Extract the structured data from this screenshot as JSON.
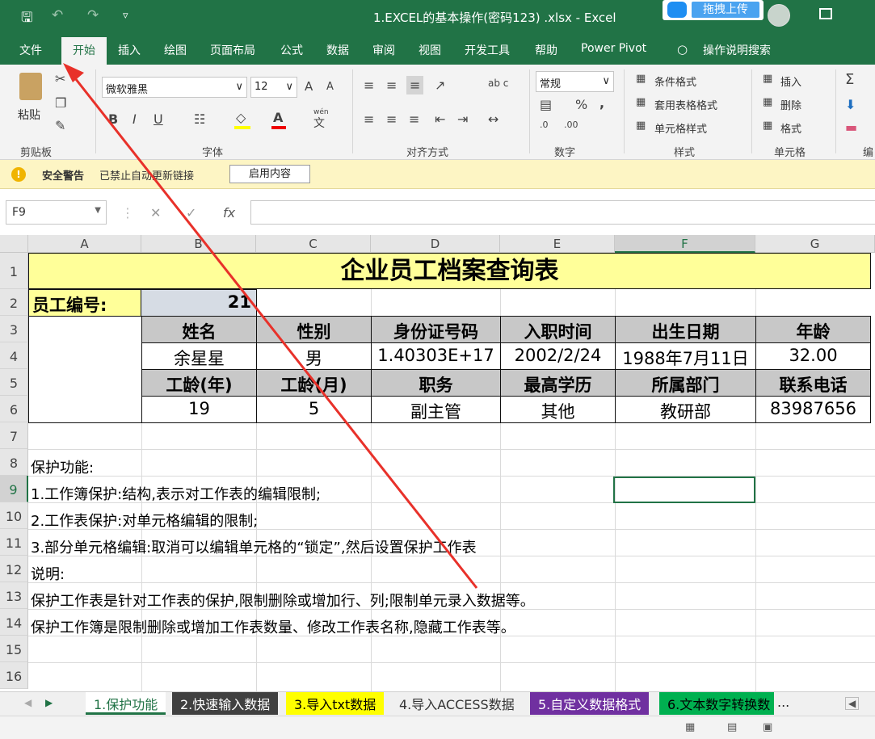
{
  "titlebar": {
    "title": "1.EXCEL的基本操作(密码123) .xlsx - Excel",
    "upload_label": "拖拽上传",
    "save_icon": "save-icon",
    "colors": {
      "excel_green": "#217346"
    }
  },
  "tabs": [
    "文件",
    "开始",
    "插入",
    "绘图",
    "页面布局",
    "公式",
    "数据",
    "审阅",
    "视图",
    "开发工具",
    "帮助",
    "Power Pivot",
    "操作说明搜索"
  ],
  "ribbon": {
    "clipboard": {
      "paste": "粘贴",
      "group": "剪贴板"
    },
    "font": {
      "family": "微软雅黑",
      "size": "12",
      "group": "字体",
      "bold": "B",
      "italic": "I",
      "underline": "U",
      "grow": "A",
      "shrink": "A",
      "wen": "wén",
      "wen2": "文"
    },
    "alignment": {
      "group": "对齐方式",
      "wrap": "ab c"
    },
    "number": {
      "format": "常规",
      "group": "数字",
      "percent": "%",
      "comma": ","
    },
    "styles": {
      "conditional": "条件格式",
      "table": "套用表格格式",
      "cell": "单元格样式",
      "group": "样式"
    },
    "cells": {
      "insert": "插入",
      "delete": "删除",
      "format": "格式",
      "group": "单元格"
    },
    "edit": {
      "sigma": "Σ",
      "group": "编"
    }
  },
  "alert": {
    "title": "安全警告",
    "message": "已禁止自动更新链接",
    "button": "启用内容"
  },
  "formula_bar": {
    "name_box": "F9",
    "cancel": "✕",
    "enter": "✓",
    "fx": "fx",
    "value": ""
  },
  "columns": [
    "A",
    "B",
    "C",
    "D",
    "E",
    "F",
    "G"
  ],
  "rows": [
    "1",
    "2",
    "3",
    "4",
    "5",
    "6",
    "7",
    "8",
    "9",
    "10",
    "11",
    "12",
    "13",
    "14",
    "15",
    "16"
  ],
  "sheet": {
    "title": "企业员工档案查询表",
    "emp_no_label": "员工编号:",
    "emp_no_value": "21",
    "header1": [
      "姓名",
      "性别",
      "身份证号码",
      "入职时间",
      "出生日期",
      "年龄"
    ],
    "values1": [
      "余星星",
      "男",
      "1.40303E+17",
      "2002/2/24",
      "1988年7月11日",
      "32.00"
    ],
    "header2": [
      "工龄(年)",
      "工龄(月)",
      "职务",
      "最高学历",
      "所属部门",
      "联系电话"
    ],
    "values2": [
      "19",
      "5",
      "副主管",
      "其他",
      "教研部",
      "83987656"
    ],
    "notes": [
      "保护功能:",
      "1.工作簿保护:结构,表示对工作表的编辑限制;",
      "2.工作表保护:对单元格编辑的限制;",
      "3.部分单元格编辑:取消可以编辑单元格的“锁定”,然后设置保护工作表",
      "说明:",
      "保护工作表是针对工作表的保护,限制删除或增加行、列;限制单元录入数据等。",
      "保护工作簿是限制删除或增加工作表数量、修改工作表名称,隐藏工作表等。"
    ],
    "colors": {
      "title_fill": "#ffff99",
      "header_fill": "#c8c8c8",
      "empno_fill": "#d6dce4"
    }
  },
  "sheet_tabs": [
    {
      "label": "1.保护功能",
      "bg": "#ffffff",
      "fg": "#217346"
    },
    {
      "label": "2.快速输入数据",
      "bg": "#404040",
      "fg": "#ffffff"
    },
    {
      "label": "3.导入txt数据",
      "bg": "#ffff00",
      "fg": "#000000"
    },
    {
      "label": "4.导入ACCESS数据",
      "bg": "#f0f0f0",
      "fg": "#333333"
    },
    {
      "label": "5.自定义数据格式",
      "bg": "#7030a0",
      "fg": "#ffffff"
    },
    {
      "label": "6.文本数字转换数",
      "bg": "#00b050",
      "fg": "#000000"
    }
  ],
  "sheet_more": "...",
  "annotation_color": "#e8312a"
}
